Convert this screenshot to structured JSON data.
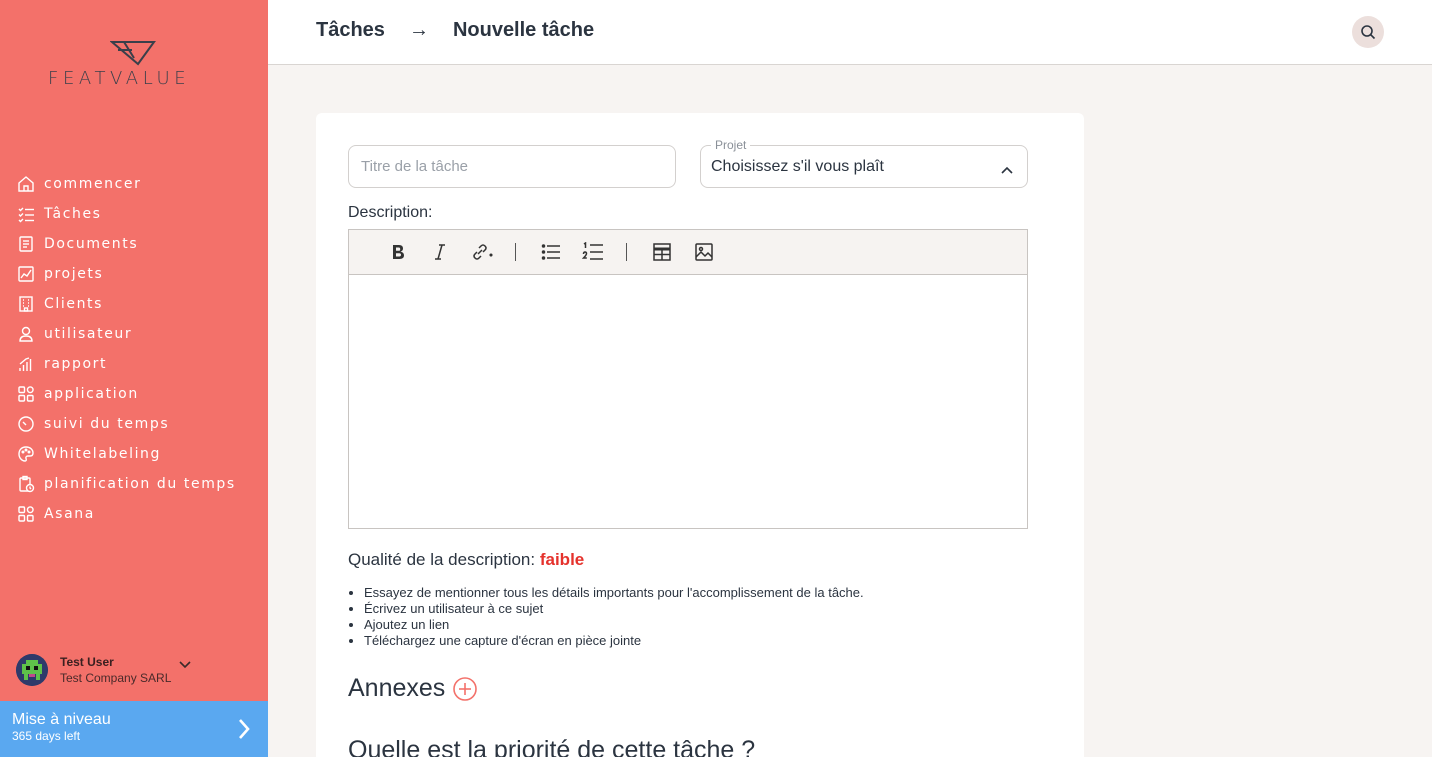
{
  "brand": {
    "name": "FEATVALUE"
  },
  "sidebar": {
    "items": [
      {
        "label": "commencer",
        "icon": "home-icon"
      },
      {
        "label": "Tâches",
        "icon": "checklist-icon"
      },
      {
        "label": "Documents",
        "icon": "document-icon"
      },
      {
        "label": "projets",
        "icon": "project-chart-icon"
      },
      {
        "label": "Clients",
        "icon": "building-icon"
      },
      {
        "label": "utilisateur",
        "icon": "user-icon"
      },
      {
        "label": "rapport",
        "icon": "report-bars-icon"
      },
      {
        "label": "application",
        "icon": "apps-grid-icon"
      },
      {
        "label": "suivi du temps",
        "icon": "timer-icon"
      },
      {
        "label": "Whitelabeling",
        "icon": "palette-icon"
      },
      {
        "label": "planification du temps",
        "icon": "clipboard-clock-icon"
      },
      {
        "label": "Asana",
        "icon": "apps-grid-icon"
      }
    ],
    "user": {
      "name": "Test User",
      "company": "Test Company SARL"
    },
    "upgrade": {
      "title": "Mise à niveau",
      "subtitle": "365 days left"
    }
  },
  "header": {
    "breadcrumb": {
      "parent": "Tâches",
      "arrow": "→",
      "current": "Nouvelle tâche"
    }
  },
  "form": {
    "title_placeholder": "Titre de la tâche",
    "project": {
      "legend": "Projet",
      "value": "Choisissez s'il vous plaît"
    },
    "description_label": "Description:",
    "quality": {
      "label": "Qualité de la description:",
      "value": "faible",
      "value_color": "#e5322c"
    },
    "tips": [
      "Essayez de mentionner tous les détails importants pour l'accomplissement de la tâche.",
      "Écrivez un utilisateur à ce sujet",
      "Ajoutez un lien",
      "Téléchargez une capture d'écran en pièce jointe"
    ],
    "annexes_title": "Annexes",
    "priority_title": "Quelle est la priorité de cette tâche ?"
  },
  "colors": {
    "sidebar": "#f3716a",
    "upgrade": "#5aa8f0",
    "accent_red": "#e5322c"
  }
}
